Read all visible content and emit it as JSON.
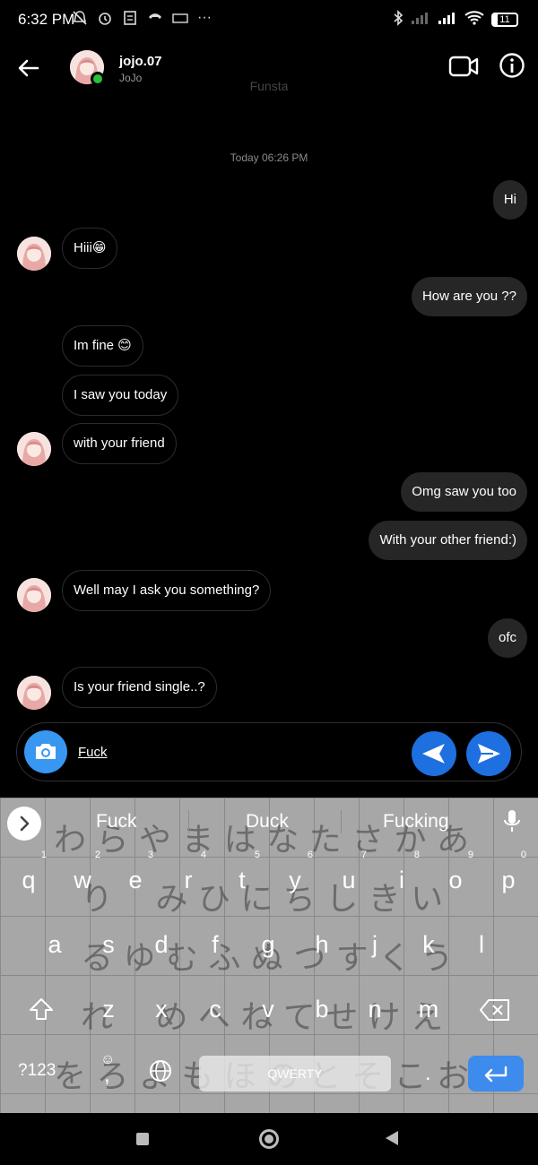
{
  "status_bar": {
    "time": "6:32 PM",
    "left_icons": [
      "mute-icon",
      "alarm-icon",
      "notes-icon",
      "call-icon",
      "keyboard-icon",
      "more-icon"
    ],
    "more": "···",
    "right_icons": [
      "bluetooth-icon",
      "signal-icon",
      "signal-icon",
      "wifi-icon"
    ],
    "battery": "11"
  },
  "header": {
    "username": "jojo.07",
    "display_name": "JoJo",
    "subtitle": "Funsta",
    "online_color": "#2ac13a"
  },
  "chat": {
    "timestamp": "Today 06:26 PM",
    "messages": [
      {
        "from": "me",
        "text": "Hi"
      },
      {
        "from": "them",
        "text": "Hiii😁"
      },
      {
        "from": "me",
        "text": "How are you ??"
      },
      {
        "from": "them",
        "text": "Im fine 😊"
      },
      {
        "from": "them",
        "text": "I saw you today"
      },
      {
        "from": "them",
        "text": "with your friend"
      },
      {
        "from": "me",
        "text": "Omg saw you too"
      },
      {
        "from": "me",
        "text": "With your other friend:)"
      },
      {
        "from": "them",
        "text": "Well may I ask you something?"
      },
      {
        "from": "me",
        "text": "ofc"
      },
      {
        "from": "them",
        "text": "Is your friend single..?"
      }
    ]
  },
  "composer": {
    "value": "Fuck",
    "accent": "#3897f0",
    "send_color": "#1e6fe0"
  },
  "keyboard": {
    "suggestions": [
      "Fuck",
      "Duck",
      "Fucking"
    ],
    "row1": [
      "q",
      "w",
      "e",
      "r",
      "t",
      "y",
      "u",
      "i",
      "o",
      "p"
    ],
    "row1_hints": [
      "1",
      "2",
      "3",
      "4",
      "5",
      "6",
      "7",
      "8",
      "9",
      "0"
    ],
    "row2": [
      "a",
      "s",
      "d",
      "f",
      "g",
      "h",
      "j",
      "k",
      "l"
    ],
    "row3": [
      "z",
      "x",
      "c",
      "v",
      "b",
      "n",
      "m"
    ],
    "symbols_label": "?123",
    "comma": ",",
    "period": ".",
    "space_label": "QWERTY",
    "enter_color": "#3d8bec"
  }
}
